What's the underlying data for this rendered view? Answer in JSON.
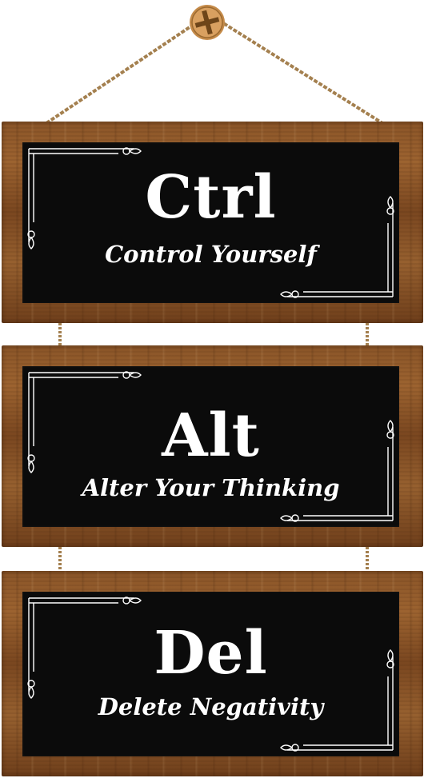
{
  "signs": [
    {
      "word": "Ctrl",
      "phrase": "Control Yourself"
    },
    {
      "word": "Alt",
      "phrase": "Alter Your Thinking"
    },
    {
      "word": "Del",
      "phrase": "Delete Negativity"
    }
  ],
  "colors": {
    "wood": "#8a5528",
    "panel": "#0b0b0b",
    "text": "#ffffff",
    "rope": "#b08a5c",
    "screw": "#c8904f"
  },
  "icons": {
    "hanger": "screw-icon",
    "ornament": "corner-flourish-icon"
  }
}
